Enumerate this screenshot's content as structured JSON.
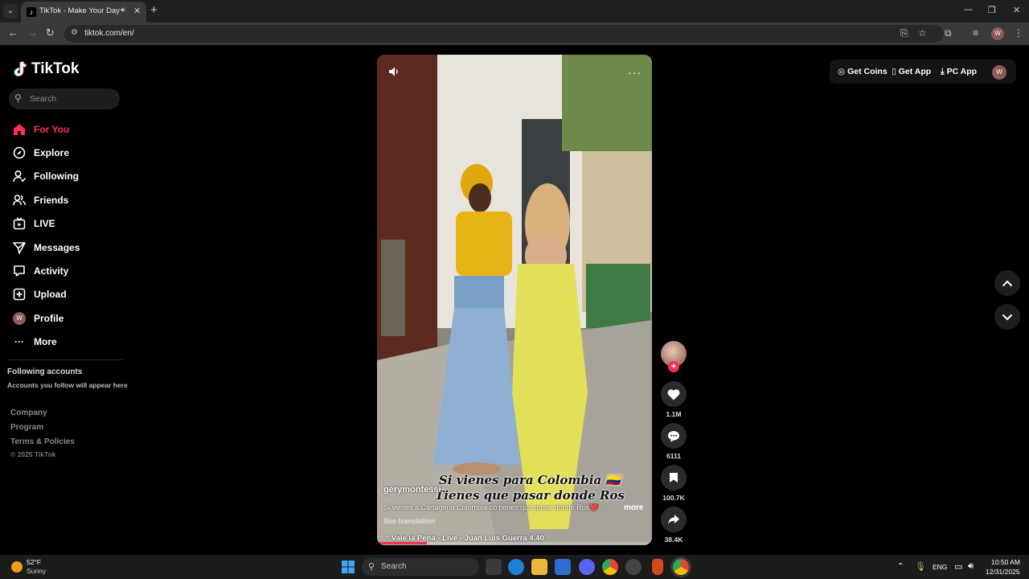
{
  "browser": {
    "tab_title": "TikTok - Make Your Day",
    "url": "tiktok.com/en/",
    "profile_initial": "W"
  },
  "sidebar": {
    "brand": "TikTok",
    "search_placeholder": "Search",
    "items": [
      {
        "label": "For You",
        "icon": "home-icon",
        "active": true
      },
      {
        "label": "Explore",
        "icon": "compass-icon"
      },
      {
        "label": "Following",
        "icon": "user-follow-icon"
      },
      {
        "label": "Friends",
        "icon": "friends-icon"
      },
      {
        "label": "LIVE",
        "icon": "live-icon"
      },
      {
        "label": "Messages",
        "icon": "send-icon"
      },
      {
        "label": "Activity",
        "icon": "activity-icon"
      },
      {
        "label": "Upload",
        "icon": "plus-square-icon"
      },
      {
        "label": "Profile",
        "icon": "avatar",
        "initial": "W"
      },
      {
        "label": "More",
        "icon": "more-icon"
      }
    ],
    "following_title": "Following accounts",
    "following_sub": "Accounts you follow will appear here",
    "footer": [
      "Company",
      "Program",
      "Terms & Policies"
    ],
    "copyright": "© 2025 TikTok"
  },
  "video": {
    "overlay_caption_line1": "Si vienes para Colombia 🇨🇴",
    "overlay_caption_line2": "Tienes que pasar donde Ros",
    "author": "gerymontessi",
    "description": "Si vienes a Cartagena Colombia co tienes que pasar dondé Ros❤️ ·",
    "more_label": "more",
    "see_translation": "See translation",
    "music": "Vale la Pena - Live - Juan Luis Guerra 4.40",
    "progress": 0.18
  },
  "actions": {
    "likes": "1.1M",
    "comments": "6111",
    "saves": "100.7K",
    "shares": "38.4K"
  },
  "header": {
    "get_coins": "Get Coins",
    "get_app": "Get App",
    "pc_app": "PC App",
    "avatar_initial": "W"
  },
  "taskbar": {
    "temp": "52°F",
    "weather": "Sunny",
    "search": "Search",
    "lang": "ENG",
    "time": "10:50 AM",
    "date": "12/31/2025"
  },
  "colors": {
    "accent": "#fe2c55",
    "background": "#000000"
  }
}
